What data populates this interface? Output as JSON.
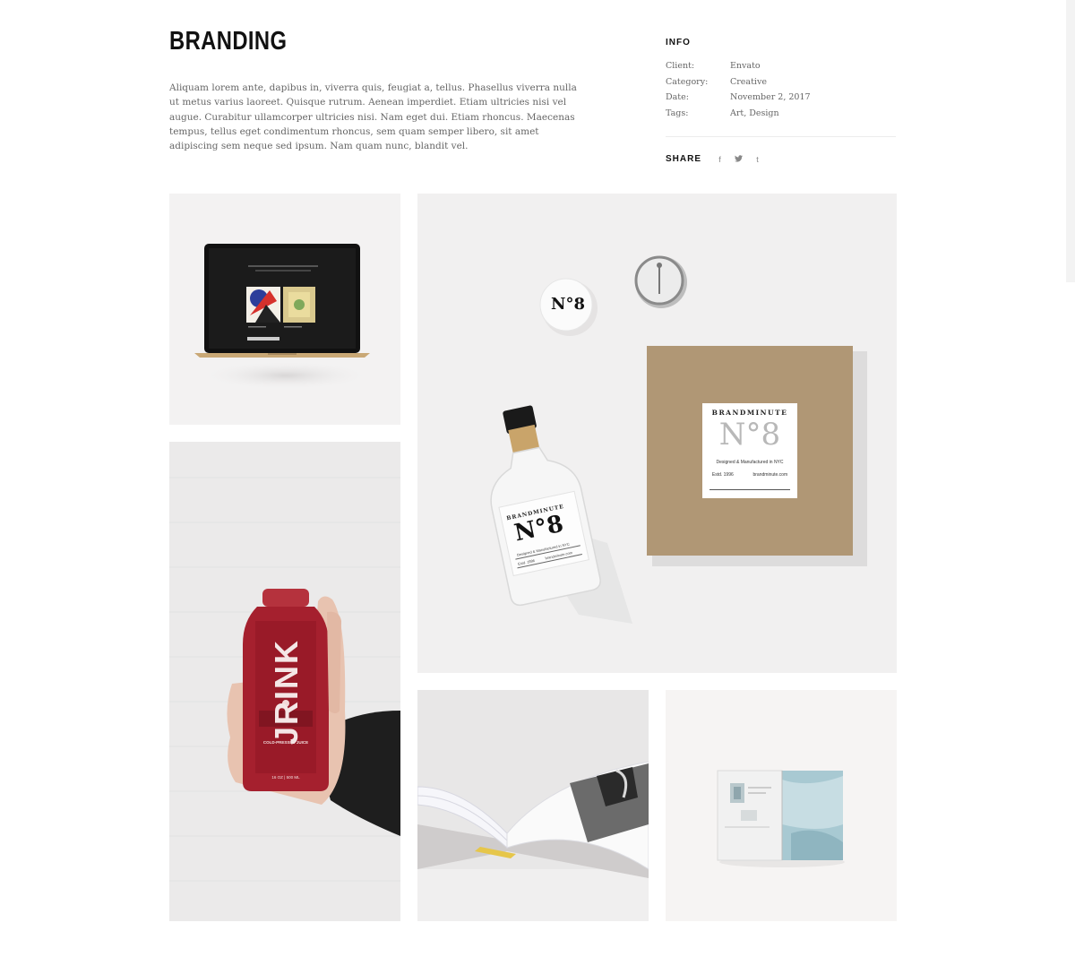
{
  "page": {
    "title": "BRANDING",
    "description": "Aliquam lorem ante, dapibus in, viverra quis, feugiat a, tellus. Phasellus viverra nulla ut metus varius laoreet. Quisque rutrum. Aenean imperdiet. Etiam ultricies nisi vel augue. Curabitur ullamcorper ultricies nisi. Nam eget dui. Etiam rhoncus. Maecenas tempus, tellus eget condimentum rhoncus, sem quam semper libero, sit amet adipiscing sem neque sed ipsum. Nam quam nunc, blandit vel."
  },
  "info": {
    "heading": "INFO",
    "rows": [
      {
        "label": "Client:",
        "value": "Envato"
      },
      {
        "label": "Category:",
        "value": "Creative"
      },
      {
        "label": "Date:",
        "value": "November 2, 2017"
      },
      {
        "label": "Tags:",
        "value": "Art, Design"
      }
    ]
  },
  "share": {
    "label": "SHARE",
    "icons": [
      {
        "name": "facebook-icon",
        "glyph": "f"
      },
      {
        "name": "twitter-icon",
        "glyph": "🐦"
      },
      {
        "name": "tumblr-icon",
        "glyph": "t"
      }
    ]
  },
  "gallery": {
    "box_label": {
      "brand": "BRANDMINUTE",
      "number": "N°8",
      "line": "Designed & Manufactured in NYC",
      "estd": "Estd. 1996",
      "url": "brandminute.com"
    },
    "bottle_label": {
      "brand": "BRANDMINUTE",
      "number": "N°8",
      "line": "Designed & Manufactured in NYC",
      "estd": "Estd. 1996",
      "url": "brandminute.com"
    },
    "pin_label": "N°8",
    "juice_label": "JRINK",
    "juice_small": "COLD-PRESSED JUICE",
    "juice_volume": "16 OZ | 500 ML"
  }
}
